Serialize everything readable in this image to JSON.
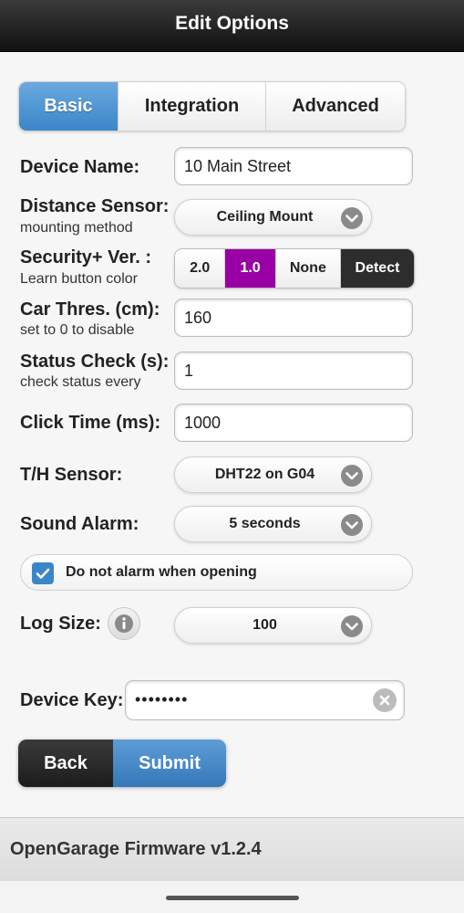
{
  "header": {
    "title": "Edit Options"
  },
  "tabs": [
    {
      "label": "Basic",
      "active": true
    },
    {
      "label": "Integration",
      "active": false
    },
    {
      "label": "Advanced",
      "active": false
    }
  ],
  "form": {
    "device_name": {
      "label": "Device Name:",
      "value": "10 Main Street"
    },
    "distance_sensor": {
      "label": "Distance Sensor:",
      "sublabel": "mounting method",
      "value": "Ceiling Mount"
    },
    "security": {
      "label": "Security+ Ver. :",
      "sublabel": "Learn button color",
      "options": [
        "2.0",
        "1.0",
        "None",
        "Detect"
      ],
      "selected": "1.0",
      "selected_color": "#9900a6"
    },
    "car_threshold": {
      "label": "Car Thres. (cm):",
      "sublabel": "set to 0 to disable",
      "value": "160"
    },
    "status_check": {
      "label": "Status Check (s):",
      "sublabel": "check status every",
      "value": "1"
    },
    "click_time": {
      "label": "Click Time (ms):",
      "value": "1000"
    },
    "th_sensor": {
      "label": "T/H Sensor:",
      "value": "DHT22 on G04"
    },
    "sound_alarm": {
      "label": "Sound Alarm:",
      "value": "5 seconds"
    },
    "no_alarm_opening": {
      "label": "Do not alarm when opening",
      "checked": true
    },
    "log_size": {
      "label": "Log Size:",
      "value": "100"
    },
    "device_key": {
      "label": "Device Key:",
      "value": "••••••••"
    }
  },
  "buttons": {
    "back": "Back",
    "submit": "Submit"
  },
  "footer": {
    "text": "OpenGarage Firmware v1.2.4"
  },
  "colors": {
    "accent": "#3b86c8",
    "header_bg": "#1a1a1a",
    "purple": "#9900a6"
  }
}
